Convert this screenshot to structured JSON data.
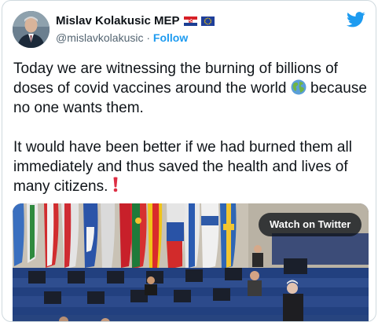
{
  "tweet": {
    "author_name": "Mislav Kolakusic MEP",
    "handle": "@mislavkolakusic",
    "separator": " · ",
    "follow_label": "Follow",
    "flags": [
      "croatia-flag-icon",
      "eu-flag-icon"
    ],
    "paragraph1": "Today we are witnessing the burning of billions of doses of covid vaccines around the world",
    "paragraph1_end": "because no one wants them.",
    "paragraph2": "It would have been better if we had burned them all immediately and thus saved the health and lives of many citizens.",
    "emoji": [
      "globe-icon",
      "red-exclamation-icon"
    ]
  },
  "media": {
    "watch_label": "Watch on Twitter"
  },
  "colors": {
    "accent": "#1d9bf0",
    "text": "#0f1419",
    "secondary": "#536471",
    "border": "#cfd9de"
  }
}
